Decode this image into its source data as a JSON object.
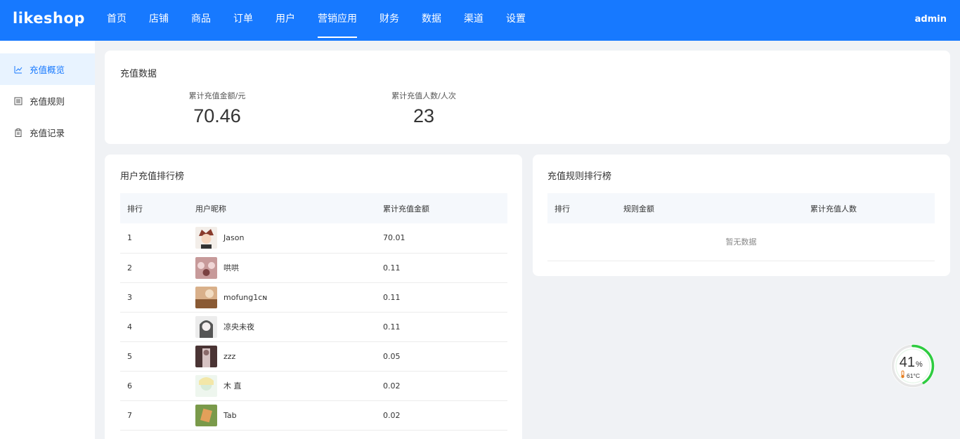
{
  "header": {
    "logo": "likeshop",
    "nav": [
      "首页",
      "店铺",
      "商品",
      "订单",
      "用户",
      "营销应用",
      "财务",
      "数据",
      "渠道",
      "设置"
    ],
    "active_nav": "营销应用",
    "user": "admin"
  },
  "sidebar": {
    "items": [
      {
        "label": "充值概览",
        "icon": "chart-line-icon",
        "active": true
      },
      {
        "label": "充值规则",
        "icon": "list-icon",
        "active": false
      },
      {
        "label": "充值记录",
        "icon": "clipboard-icon",
        "active": false
      }
    ]
  },
  "overview": {
    "title": "充值数据",
    "stats": [
      {
        "label": "累计充值金额/元",
        "value": "70.46"
      },
      {
        "label": "累计充值人数/人次",
        "value": "23"
      }
    ]
  },
  "user_ranking": {
    "title": "用户充值排行榜",
    "columns": [
      "排行",
      "用户昵称",
      "累计充值金额"
    ],
    "rows": [
      {
        "rank": "1",
        "name": "Jason",
        "amount": "70.01",
        "avatar_color": "#8a5a44"
      },
      {
        "rank": "2",
        "name": "哄哄",
        "amount": "0.11",
        "avatar_color": "#b07a7a"
      },
      {
        "rank": "3",
        "name": "mofung1ᴄɴ",
        "amount": "0.11",
        "avatar_color": "#a06a3e"
      },
      {
        "rank": "4",
        "name": "凉央未夜",
        "amount": "0.11",
        "avatar_color": "#9a9a9a"
      },
      {
        "rank": "5",
        "name": "zzz",
        "amount": "0.05",
        "avatar_color": "#6b4b4b"
      },
      {
        "rank": "6",
        "name": "木 直",
        "amount": "0.02",
        "avatar_color": "#cfe3d6"
      },
      {
        "rank": "7",
        "name": "Tab",
        "amount": "0.02",
        "avatar_color": "#7a9a4a"
      }
    ]
  },
  "rule_ranking": {
    "title": "充值规则排行榜",
    "columns": [
      "排行",
      "规则金额",
      "累计充值人数"
    ],
    "empty_text": "暂无数据"
  },
  "gauge": {
    "percent": "41",
    "unit": "%",
    "temperature": "61°C",
    "color": "#2ecc40"
  },
  "colors": {
    "brand": "#1779ff"
  }
}
